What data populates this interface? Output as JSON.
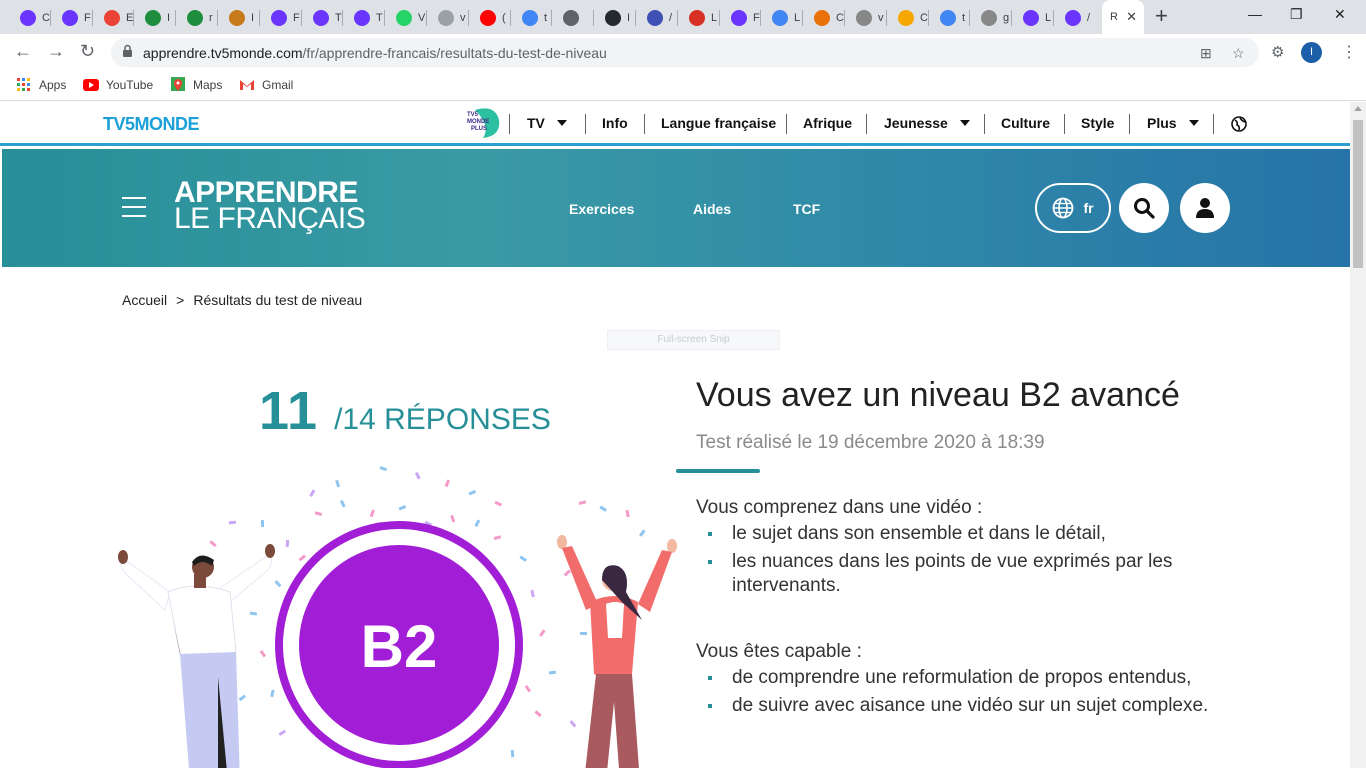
{
  "browser": {
    "tabs": [
      {
        "icon": "tv5-icon",
        "color": "#6a35ff",
        "label": "C"
      },
      {
        "icon": "tv5-icon",
        "color": "#6a35ff",
        "label": "F"
      },
      {
        "icon": "gmail-icon",
        "color": "#ea4335",
        "label": "E"
      },
      {
        "icon": "cross-icon",
        "color": "#1e8e3e",
        "label": "I"
      },
      {
        "icon": "cross-icon",
        "color": "#1e8e3e",
        "label": "r"
      },
      {
        "icon": "doc-icon",
        "color": "#c77a1a",
        "label": "I"
      },
      {
        "icon": "tv5-icon",
        "color": "#6a35ff",
        "label": "F"
      },
      {
        "icon": "tv5-icon",
        "color": "#6a35ff",
        "label": "T"
      },
      {
        "icon": "tv5-icon",
        "color": "#6a35ff",
        "label": "T"
      },
      {
        "icon": "whatsapp-icon",
        "color": "#25d366",
        "label": "V"
      },
      {
        "icon": "clock-icon",
        "color": "#9aa0a6",
        "label": "v"
      },
      {
        "icon": "youtube-icon",
        "color": "#ff0000",
        "label": "("
      },
      {
        "icon": "google-icon",
        "color": "#4285f4",
        "label": "t"
      },
      {
        "icon": "link-icon",
        "color": "#5f6368",
        "label": ""
      },
      {
        "icon": "github-icon",
        "color": "#24292e",
        "label": "I"
      },
      {
        "icon": "figure-icon",
        "color": "#3f51b5",
        "label": "/"
      },
      {
        "icon": "tv-icon",
        "color": "#d93025",
        "label": "L"
      },
      {
        "icon": "tv5-icon",
        "color": "#6a35ff",
        "label": "F"
      },
      {
        "icon": "google-icon",
        "color": "#4285f4",
        "label": "L"
      },
      {
        "icon": "ring-icon",
        "color": "#e8710a",
        "label": "C"
      },
      {
        "icon": "drive-icon",
        "color": "#888888",
        "label": "v"
      },
      {
        "icon": "face-icon",
        "color": "#f6a800",
        "label": "C"
      },
      {
        "icon": "google-icon",
        "color": "#4285f4",
        "label": "t"
      },
      {
        "icon": "drive-icon",
        "color": "#888888",
        "label": "g"
      },
      {
        "icon": "tv5-icon",
        "color": "#6a35ff",
        "label": "L"
      },
      {
        "icon": "tv5-icon",
        "color": "#6a35ff",
        "label": "/"
      }
    ],
    "active_tab_label": "R",
    "url_host": "apprendre.tv5monde.com",
    "url_path": "/fr/apprendre-francais/resultats-du-test-de-niveau",
    "profile_initial": "I",
    "bookmarks": [
      {
        "label": "Apps"
      },
      {
        "label": "YouTube"
      },
      {
        "label": "Maps"
      },
      {
        "label": "Gmail"
      }
    ]
  },
  "site": {
    "logo": "TV5MONDE",
    "plus_logo_text": "TV5 MONDE PLUS",
    "topnav": [
      "TV",
      "Info",
      "Langue française",
      "Afrique",
      "Jeunesse",
      "Culture",
      "Style",
      "Plus"
    ],
    "brand_line1": "APPRENDRE",
    "brand_line2": "LE FRANÇAIS",
    "hero_nav": [
      "Exercices",
      "Aides",
      "TCF"
    ],
    "lang": "fr",
    "colors": {
      "teal": "#268f97",
      "purple": "#a21ed6",
      "topline": "#2a9fd6"
    }
  },
  "breadcrumb": {
    "home": "Accueil",
    "sep": ">",
    "current": "Résultats du test de niveau"
  },
  "snip_label": "Full-screen Snip",
  "score": {
    "correct": "11",
    "total": "/14 RÉPONSES"
  },
  "level_badge": "B2",
  "result": {
    "title": "Vous avez un niveau B2 avancé",
    "date": "Test réalisé le 19 décembre 2020 à 18:39",
    "block1_intro": "Vous comprenez dans une vidéo :",
    "block1_items": [
      "le sujet dans son ensemble et dans le détail,",
      "les nuances dans les points de vue exprimés par les intervenants."
    ],
    "block2_intro": "Vous êtes capable :",
    "block2_items": [
      "de comprendre une reformulation de propos entendus,",
      "de suivre avec aisance une vidéo sur un sujet complexe."
    ]
  }
}
